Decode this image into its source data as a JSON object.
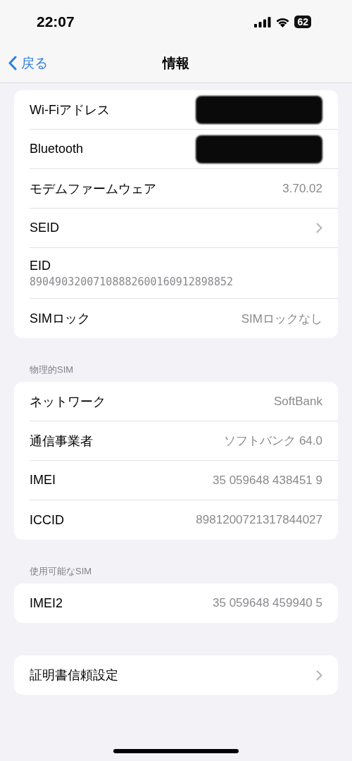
{
  "status_bar": {
    "time": "22:07",
    "battery": "62"
  },
  "nav": {
    "back": "戻る",
    "title": "情報"
  },
  "sections": [
    {
      "rows": [
        {
          "kind": "redacted",
          "label": "Wi-Fiアドレス"
        },
        {
          "kind": "redacted",
          "label": "Bluetooth"
        },
        {
          "kind": "value",
          "label": "モデムファームウェア",
          "value": "3.70.02"
        },
        {
          "kind": "link",
          "label": "SEID"
        },
        {
          "kind": "stacked",
          "label": "EID",
          "value": "89049032007108882600160912898852"
        },
        {
          "kind": "value",
          "label": "SIMロック",
          "value": "SIMロックなし"
        }
      ]
    },
    {
      "header": "物理的SIM",
      "rows": [
        {
          "kind": "value",
          "label": "ネットワーク",
          "value": "SoftBank"
        },
        {
          "kind": "value",
          "label": "通信事業者",
          "value": "ソフトバンク 64.0"
        },
        {
          "kind": "value",
          "label": "IMEI",
          "value": "35 059648 438451 9"
        },
        {
          "kind": "value",
          "label": "ICCID",
          "value": "8981200721317844027"
        }
      ]
    },
    {
      "header": "使用可能なSIM",
      "rows": [
        {
          "kind": "value",
          "label": "IMEI2",
          "value": "35 059648 459940 5"
        }
      ]
    },
    {
      "rows": [
        {
          "kind": "link",
          "label": "証明書信頼設定"
        }
      ]
    }
  ]
}
